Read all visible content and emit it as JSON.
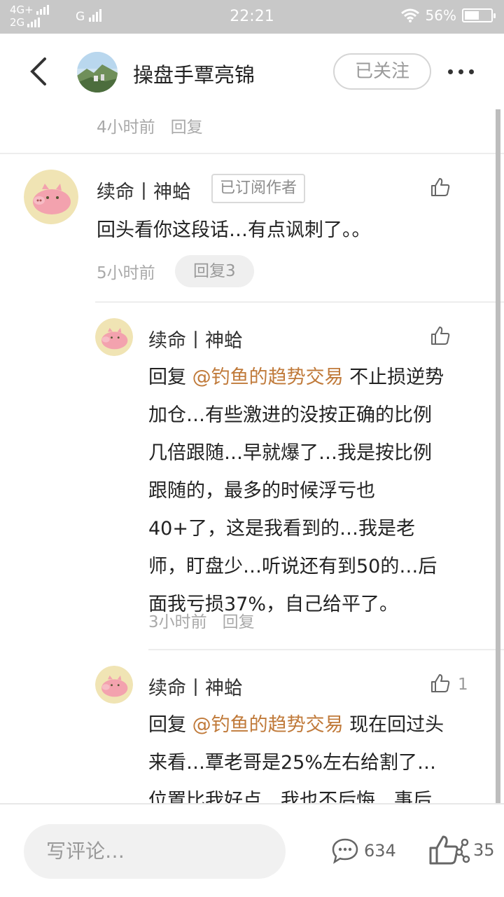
{
  "status_bar": {
    "net1": "4G+",
    "net2": "2G",
    "net3": "G",
    "time": "22:21",
    "battery": "56%",
    "battery_level": 0.56
  },
  "header": {
    "title": "操盘手覃亮锦",
    "follow_label": "已关注"
  },
  "top_meta": {
    "time": "4小时前",
    "reply": "回复"
  },
  "comments": [
    {
      "name": "续命丨神蛤",
      "badge": "已订阅作者",
      "text": "回头看你这段话…有点讽刺了。。",
      "time": "5小时前",
      "reply": "回复3"
    },
    {
      "name": "续命丨神蛤",
      "prefix": "回复 ",
      "mention": "@钓鱼的趋势交易",
      "line1_rest": " 不止损逆势",
      "lines": [
        "加仓…有些激进的没按正确的比例",
        "几倍跟随…早就爆了…我是按比例",
        "跟随的，最多的时候浮亏也",
        "40+了，这是我看到的…我是老",
        "师，盯盘少…听说还有到50的…后",
        "面我亏损37%，自己给平了。"
      ],
      "time": "3小时前",
      "reply": "回复"
    },
    {
      "name": "续命丨神蛤",
      "like_count": "1",
      "prefix": "回复 ",
      "mention": "@钓鱼的趋势交易",
      "line1_rest": " 现在回过头",
      "lines": [
        "来看…覃老哥是25%左右给割了…",
        "位置比我好点…我也不后悔…事后"
      ]
    }
  ],
  "bottom": {
    "placeholder": "写评论…",
    "comment_count": "634",
    "like_count": "35"
  },
  "colors": {
    "mention": "#c07a3a",
    "status_bar": "#c8c8c8"
  }
}
